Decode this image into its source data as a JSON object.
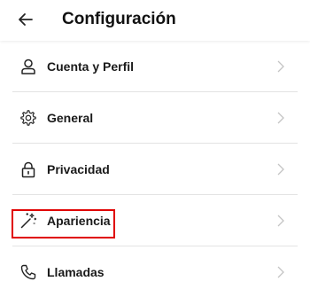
{
  "header": {
    "title": "Configuración",
    "back_icon": "arrow-left-icon"
  },
  "items": [
    {
      "label": "Cuenta y Perfil",
      "icon": "user-icon"
    },
    {
      "label": "General",
      "icon": "gear-icon"
    },
    {
      "label": "Privacidad",
      "icon": "lock-icon"
    },
    {
      "label": "Apariencia",
      "icon": "magic-wand-icon",
      "highlighted": true
    },
    {
      "label": "Llamadas",
      "icon": "phone-icon"
    }
  ],
  "colors": {
    "highlight": "#e00000",
    "divider": "#e3e3e3",
    "chevron": "#c4c4c4"
  }
}
